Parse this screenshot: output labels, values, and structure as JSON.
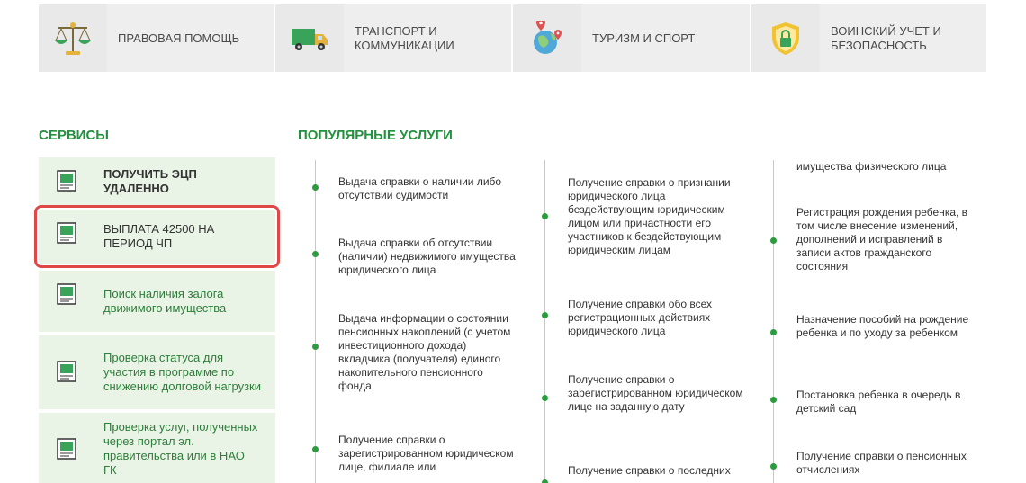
{
  "categories": [
    {
      "label": "ПРАВОВАЯ ПОМОЩЬ",
      "icon": "scales-icon"
    },
    {
      "label": "ТРАНСПОРТ И КОММУНИКАЦИИ",
      "icon": "truck-icon"
    },
    {
      "label": "ТУРИЗМ И СПОРТ",
      "icon": "globe-pin-icon"
    },
    {
      "label": "ВОИНСКИЙ УЧЕТ И БЕЗОПАСНОСТЬ",
      "icon": "shield-lock-icon"
    }
  ],
  "sections": {
    "services_title": "СЕРВИСЫ",
    "popular_title": "ПОПУЛЯРНЫЕ УСЛУГИ"
  },
  "services": [
    {
      "label": "ПОЛУЧИТЬ ЭЦП УДАЛЕННО"
    },
    {
      "label": "ВЫПЛАТА 42500 НА ПЕРИОД ЧП"
    },
    {
      "label": "Поиск наличия залога движимого имущества"
    },
    {
      "label": "Проверка статуса для участия в программе по снижению долговой нагрузки"
    },
    {
      "label": "Проверка услуг, полученных через портал эл. правительства или в НАО ГК"
    }
  ],
  "popular": {
    "col1": [
      "Выдача справки о наличии либо отсутствии судимости",
      "Выдача справки об отсутствии (наличии) недвижимого имущества юридического лица",
      "Выдача информации о состоянии пенсионных накоплений (с учетом инвестиционного дохода) вкладчика (получателя) единого накопительного пенсионного фонда",
      "Получение справки о зарегистрированном юридическом лице, филиале или"
    ],
    "col2": [
      "Получение справки о признании юридического лица бездействующим юридическим лицом или причастности его участников к бездействующим юридическим лицам",
      "Получение справки обо всех регистрационных действиях юридического лица",
      "Получение справки о зарегистрированном юридическом лице на заданную дату",
      "Получение справки о последних"
    ],
    "col3": [
      "имущества физического лица",
      "Регистрация рождения ребенка, в том числе внесение изменений, дополнений и исправлений в записи актов гражданского состояния",
      "Назначение пособий на рождение ребенка и по уходу за ребенком",
      "Постановка ребенка в очередь в детский сад",
      "Получение справки о пенсионных отчислениях"
    ]
  },
  "colors": {
    "accent": "#23913f",
    "service_bg": "#e9f4e6",
    "highlight": "#e04848"
  }
}
